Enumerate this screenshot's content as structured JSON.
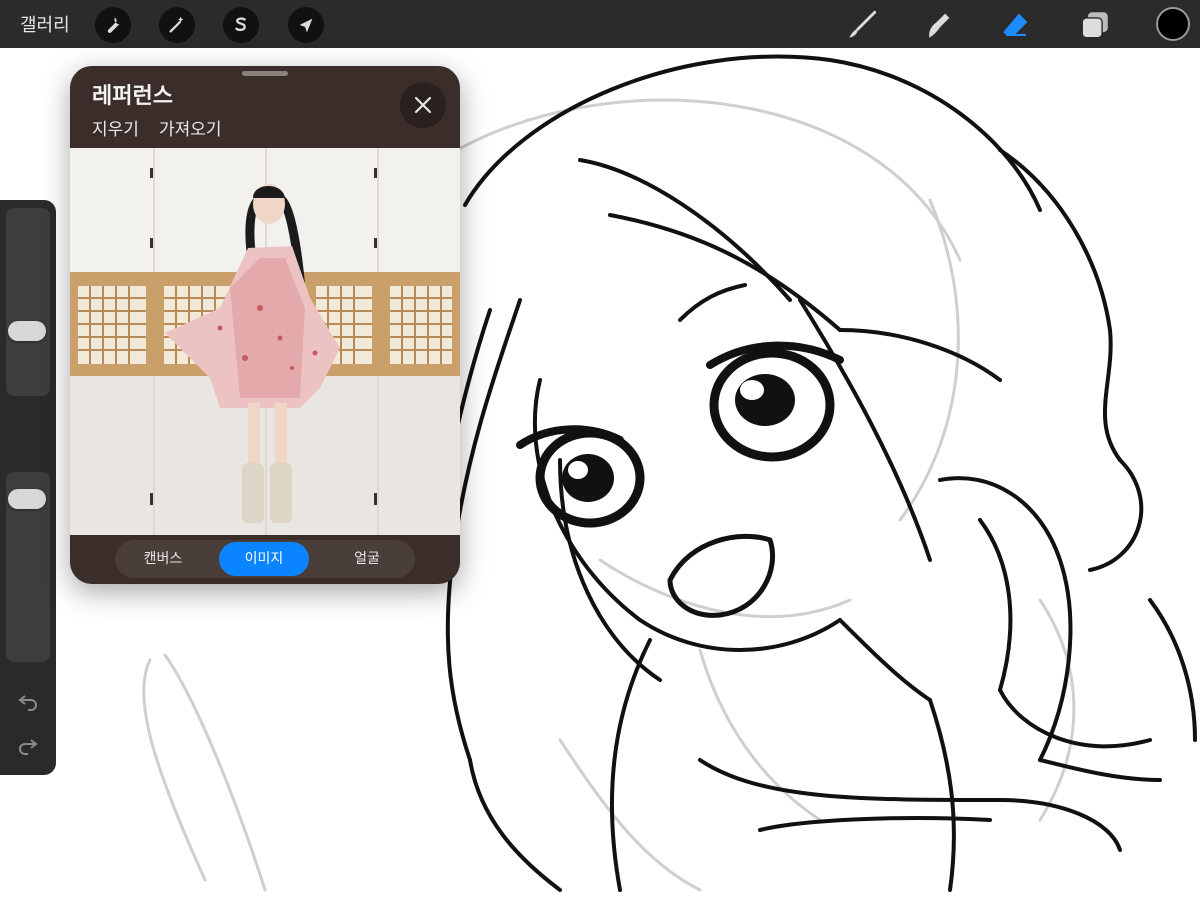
{
  "toolbar": {
    "gallery_label": "갤러리",
    "left_tools": [
      "wrench-icon",
      "magic-wand-icon",
      "selection-s-icon",
      "transform-arrow-icon"
    ],
    "right_tools": [
      "brush-icon",
      "smudge-icon",
      "eraser-icon",
      "layers-icon"
    ],
    "active_tool": "eraser-icon",
    "color": "#000000",
    "accent": "#0a84ff"
  },
  "sidebar": {
    "brush_size_level": 0.68,
    "opacity_level": 0.08,
    "icons": [
      "modify-square-icon",
      "undo-icon",
      "redo-icon"
    ]
  },
  "reference": {
    "title": "레퍼런스",
    "actions": {
      "clear": "지우기",
      "import": "가져오기"
    },
    "tabs": [
      {
        "label": "캔버스",
        "active": false
      },
      {
        "label": "이미지",
        "active": true
      },
      {
        "label": "얼굴",
        "active": false
      }
    ],
    "close_icon": "close-icon"
  }
}
